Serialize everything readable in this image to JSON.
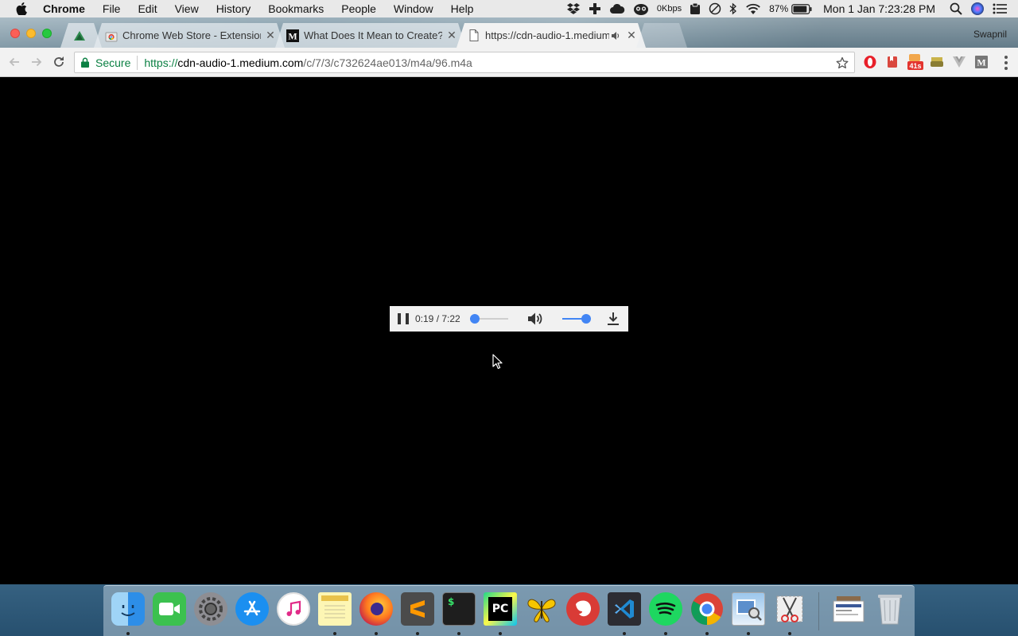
{
  "menubar": {
    "app_name": "Chrome",
    "menus": [
      "File",
      "Edit",
      "View",
      "History",
      "Bookmarks",
      "People",
      "Window",
      "Help"
    ],
    "network_speed": "0Kbps",
    "battery": "87%",
    "clock": "Mon 1 Jan  7:23:28 PM",
    "icons": [
      "dropbox-icon",
      "plus-icon",
      "cloud-icon",
      "owl-icon",
      "network-speed",
      "clipboard-icon",
      "vpn-icon",
      "bluetooth-icon",
      "wifi-icon",
      "battery-icon",
      "spotlight-icon",
      "siri-icon",
      "notification-center-icon"
    ]
  },
  "browser": {
    "profile_name": "Swapnil",
    "tabs": [
      {
        "title": "",
        "icon": "app-tab-icon",
        "active": false
      },
      {
        "title": "Chrome Web Store - Extension",
        "icon": "chrome-web-store-icon",
        "active": false
      },
      {
        "title": "What Does It Mean to Create?",
        "icon": "medium-icon",
        "active": false
      },
      {
        "title": "https://cdn-audio-1.medium",
        "icon": "page-icon",
        "active": true,
        "playing_audio": true
      }
    ],
    "omnibox": {
      "security_label": "Secure",
      "url_scheme": "https://",
      "url_host": "cdn-audio-1.medium.com",
      "url_path": "/c/7/3/c732624ae013/m4a/96.m4a"
    },
    "extensions": [
      "opera-icon",
      "bookmark-ext-icon",
      "timer-ext-icon",
      "lamp-ext-icon",
      "vuejs-ext-icon",
      "medium-ext-icon"
    ],
    "timer_badge": "41s"
  },
  "player": {
    "current_time": "0:19",
    "duration": "7:22",
    "time_display": "0:19 / 7:22",
    "progress_fraction": 0.043,
    "volume_fraction": 1.0,
    "state": "playing"
  },
  "dock": {
    "apps": [
      "Finder",
      "FaceTime",
      "System Preferences",
      "App Store",
      "iTunes",
      "Notes",
      "Firefox",
      "Sublime Text",
      "Terminal",
      "PyCharm",
      "Tes",
      "Bear",
      "Visual Studio Code",
      "Spotify",
      "Chrome",
      "Preview",
      "Scissors",
      "Downloads",
      "Trash"
    ],
    "terminal_label": "$",
    "pycharm_label": "PC"
  }
}
